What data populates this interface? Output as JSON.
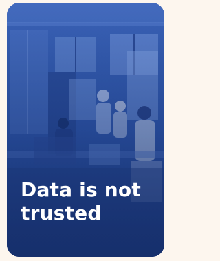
{
  "card": {
    "headline": "Data is not trusted",
    "overlay_color": "#2a4fa8",
    "page_background": "#fdf6ee"
  }
}
